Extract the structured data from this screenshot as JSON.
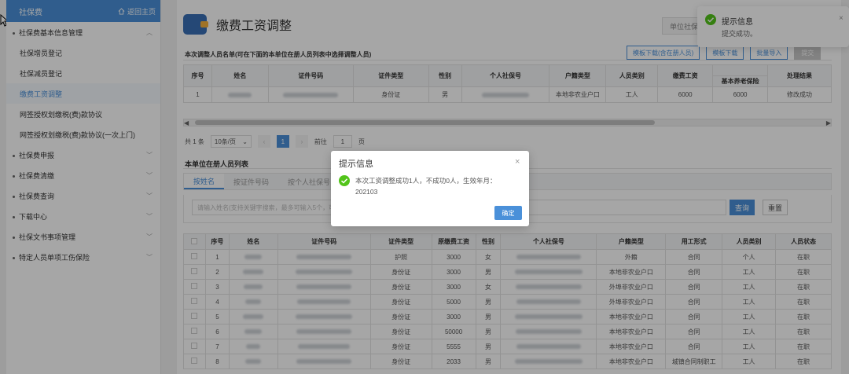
{
  "sidebar": {
    "title": "社保费",
    "home_label": "返回主页",
    "groups": [
      {
        "label": "社保费基本信息管理",
        "expanded": true,
        "items": [
          {
            "label": "社保增员登记"
          },
          {
            "label": "社保减员登记"
          },
          {
            "label": "缴费工资调整",
            "active": true
          },
          {
            "label": "网签授权划缴税(费)款协议"
          },
          {
            "label": "网签授权划缴税(费)款协议(一次上门)"
          }
        ]
      },
      {
        "label": "社保费申报"
      },
      {
        "label": "社保费清缴"
      },
      {
        "label": "社保费查询"
      },
      {
        "label": "下载中心"
      },
      {
        "label": "社保文书事项管理"
      },
      {
        "label": "特定人员单项工伤保险"
      }
    ]
  },
  "header": {
    "title": "缴费工资调整",
    "unit_button": "单位社保"
  },
  "section1": {
    "label": "本次调整人员名单(可在下面的本单位在册人员列表中选择调整人员)",
    "buttons": [
      "模板下载(含在册人员)",
      "模板下载",
      "批量导入",
      "提交"
    ],
    "columns": [
      "序号",
      "姓名",
      "证件号码",
      "证件类型",
      "性别",
      "个人社保号",
      "户籍类型",
      "人员类别",
      "缴费工资",
      "处理结果"
    ],
    "sub_column": "基本养老保险",
    "rows": [
      {
        "no": "1",
        "id_type": "身份证",
        "gender": "男",
        "hukou": "本地非农业户口",
        "category": "工人",
        "wage": "6000",
        "pension": "6000",
        "result": "修改成功"
      }
    ]
  },
  "pager": {
    "total": "共 1 条",
    "page_size": "10条/页",
    "current": "1",
    "goto_label": "前往",
    "goto_value": "1",
    "page_suffix": "页"
  },
  "section2": {
    "label": "本单位在册人员列表",
    "tabs": [
      "按姓名",
      "按证件号码",
      "按个人社保号"
    ],
    "search_placeholder": "请输入姓名(支持关键字搜索，最多可输入5个，可",
    "query_button": "查询",
    "reset_button": "重置",
    "columns": [
      "序号",
      "姓名",
      "证件号码",
      "证件类型",
      "原缴费工资",
      "性别",
      "个人社保号",
      "户籍类型",
      "用工形式",
      "人员类别",
      "人员状态"
    ],
    "rows": [
      {
        "no": "1",
        "id_type": "护照",
        "wage": "3000",
        "gender": "女",
        "hukou": "外籍",
        "employment": "合同",
        "category": "个人",
        "status": "在职"
      },
      {
        "no": "2",
        "id_type": "身份证",
        "wage": "3000",
        "gender": "男",
        "hukou": "本地非农业户口",
        "employment": "合同",
        "category": "工人",
        "status": "在职"
      },
      {
        "no": "3",
        "id_type": "身份证",
        "wage": "3000",
        "gender": "女",
        "hukou": "外埠非农业户口",
        "employment": "合同",
        "category": "工人",
        "status": "在职"
      },
      {
        "no": "4",
        "id_type": "身份证",
        "wage": "5000",
        "gender": "男",
        "hukou": "外埠非农业户口",
        "employment": "合同",
        "category": "工人",
        "status": "在职"
      },
      {
        "no": "5",
        "id_type": "身份证",
        "wage": "3000",
        "gender": "男",
        "hukou": "本地非农业户口",
        "employment": "合同",
        "category": "工人",
        "status": "在职"
      },
      {
        "no": "6",
        "id_type": "身份证",
        "wage": "50000",
        "gender": "男",
        "hukou": "本地非农业户口",
        "employment": "合同",
        "category": "工人",
        "status": "在职"
      },
      {
        "no": "7",
        "id_type": "身份证",
        "wage": "5555",
        "gender": "男",
        "hukou": "本地非农业户口",
        "employment": "合同",
        "category": "工人",
        "status": "在职"
      },
      {
        "no": "8",
        "id_type": "身份证",
        "wage": "2033",
        "gender": "男",
        "hukou": "本地非农业户口",
        "employment": "城镇合同制职工",
        "category": "工人",
        "status": "在职"
      }
    ]
  },
  "toast": {
    "title": "提示信息",
    "message": "提交成功。",
    "close": "×"
  },
  "modal": {
    "title": "提示信息",
    "close": "×",
    "message": "本次工资调整成功1人，不成功0人，生效年月：202103",
    "ok_button": "确定"
  },
  "colors": {
    "primary": "#4a90d9",
    "success": "#52c41a"
  }
}
